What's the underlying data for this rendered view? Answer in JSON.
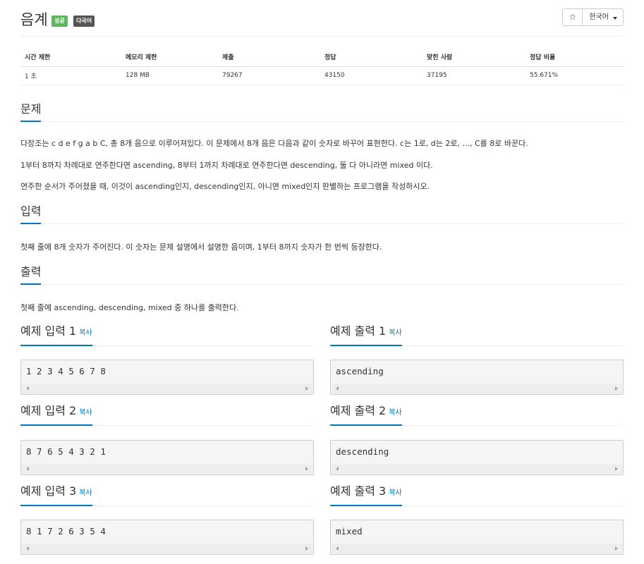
{
  "problem": {
    "title": "음계",
    "badges": {
      "success": "성공",
      "multilang": "다국어"
    }
  },
  "toolbar": {
    "star": "☆",
    "language": "한국어"
  },
  "info_table": {
    "headers": [
      "시간 제한",
      "메모리 제한",
      "제출",
      "정답",
      "맞힌 사람",
      "정답 비율"
    ],
    "values": [
      "1 초",
      "128 MB",
      "79267",
      "43150",
      "37195",
      "55.671%"
    ]
  },
  "sections": {
    "problem": {
      "title": "문제",
      "paragraphs": [
        "다장조는 c d e f g a b C, 총 8개 음으로 이루어져있다. 이 문제에서 8개 음은 다음과 같이 숫자로 바꾸어 표현한다. c는 1로, d는 2로, ..., C를 8로 바꾼다.",
        "1부터 8까지 차례대로 연주한다면 ascending, 8부터 1까지 차례대로 연주한다면 descending, 둘 다 아니라면 mixed 이다.",
        "연주한 순서가 주어졌을 때, 이것이 ascending인지, descending인지, 아니면 mixed인지 판별하는 프로그램을 작성하시오."
      ]
    },
    "input": {
      "title": "입력",
      "text": "첫째 줄에 8개 숫자가 주어진다. 이 숫자는 문제 설명에서 설명한 음이며, 1부터 8까지 숫자가 한 번씩 등장한다."
    },
    "output": {
      "title": "출력",
      "text": "첫째 줄에 ascending, descending, mixed 중 하나를 출력한다."
    }
  },
  "copy_label": "복사",
  "samples": [
    {
      "input_title": "예제 입력 1",
      "output_title": "예제 출력 1",
      "input": "1 2 3 4 5 6 7 8",
      "output": "ascending"
    },
    {
      "input_title": "예제 입력 2",
      "output_title": "예제 출력 2",
      "input": "8 7 6 5 4 3 2 1",
      "output": "descending"
    },
    {
      "input_title": "예제 입력 3",
      "output_title": "예제 출력 3",
      "input": "8 1 7 2 6 3 5 4",
      "output": "mixed"
    }
  ],
  "colors": {
    "accent": "#0076c0",
    "success": "#5cb85c",
    "badge_dark": "#555555"
  }
}
